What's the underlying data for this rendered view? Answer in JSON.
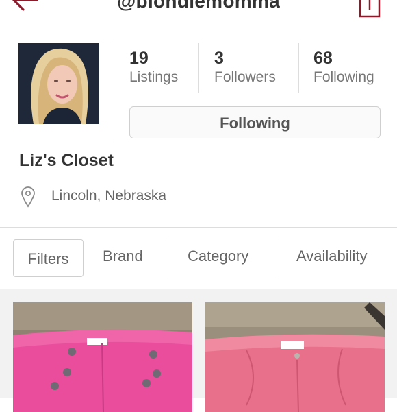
{
  "header": {
    "handle": "@blondiemomma"
  },
  "profile": {
    "avatar_alt": "profile photo"
  },
  "stats": [
    {
      "value": "19",
      "label": "Listings"
    },
    {
      "value": "3",
      "label": "Followers"
    },
    {
      "value": "68",
      "label": "Following"
    }
  ],
  "follow_button": {
    "label": "Following"
  },
  "closet": {
    "name": "Liz's Closet",
    "location": "Lincoln, Nebraska"
  },
  "filters": {
    "filters_label": "Filters",
    "brand_label": "Brand",
    "category_label": "Category",
    "availability_label": "Availability"
  },
  "colors": {
    "accent": "#8b1a2b",
    "divider": "#dddddd",
    "listing_pink_1": "#e94d9c",
    "listing_pink_2": "#e8708a"
  },
  "listings": [
    {
      "icon": "pink-shorts-photo"
    },
    {
      "icon": "coral-shorts-photo"
    }
  ]
}
